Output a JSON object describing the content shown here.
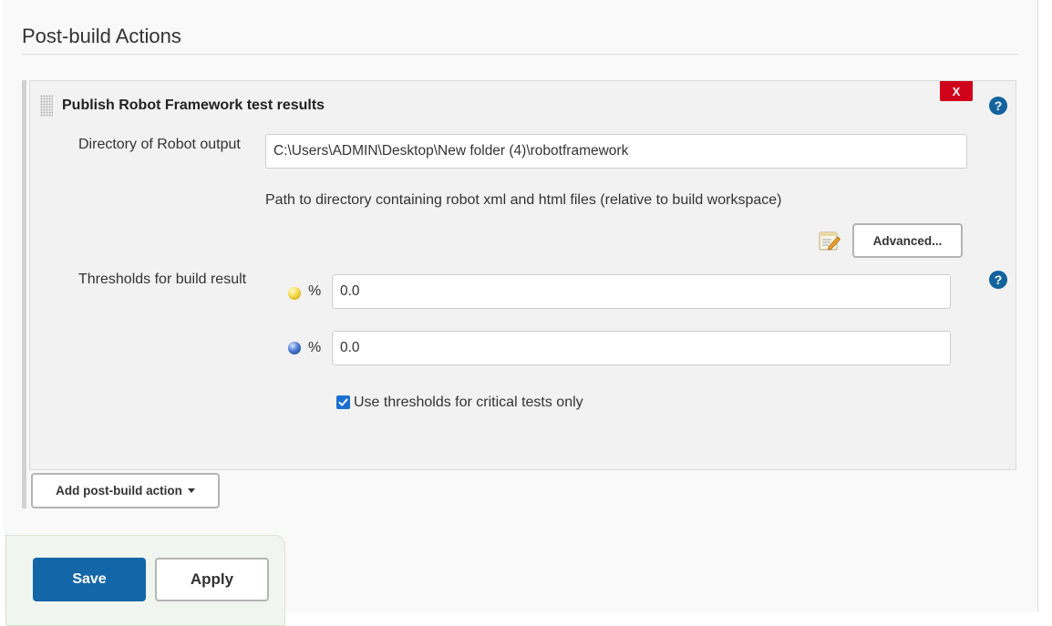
{
  "section": {
    "title": "Post-build Actions"
  },
  "panel": {
    "title": "Publish Robot Framework test results",
    "delete_label": "X",
    "help_glyph": "?"
  },
  "directory": {
    "label": "Directory of Robot output",
    "value": "C:\\Users\\ADMIN\\Desktop\\New folder (4)\\robotframework",
    "help_text": "Path to directory containing robot xml and html files (relative to build workspace)"
  },
  "advanced": {
    "label": "Advanced...",
    "icon": "notepad-edit-icon"
  },
  "thresholds": {
    "label": "Thresholds for build result",
    "unstable": {
      "icon": "yellow-ball-icon",
      "unit": "%",
      "value": "0.0"
    },
    "pass": {
      "icon": "blue-ball-icon",
      "unit": "%",
      "value": "0.0"
    },
    "critical_only": {
      "label": "Use thresholds for critical tests only",
      "checked": true
    }
  },
  "add_action": {
    "label": "Add post-build action"
  },
  "footer": {
    "save_label": "Save",
    "apply_label": "Apply"
  },
  "colors": {
    "delete_red": "#d0021b",
    "help_blue": "#14639e",
    "save_blue": "#1366a8",
    "checkbox_blue": "#1b6fd1"
  }
}
